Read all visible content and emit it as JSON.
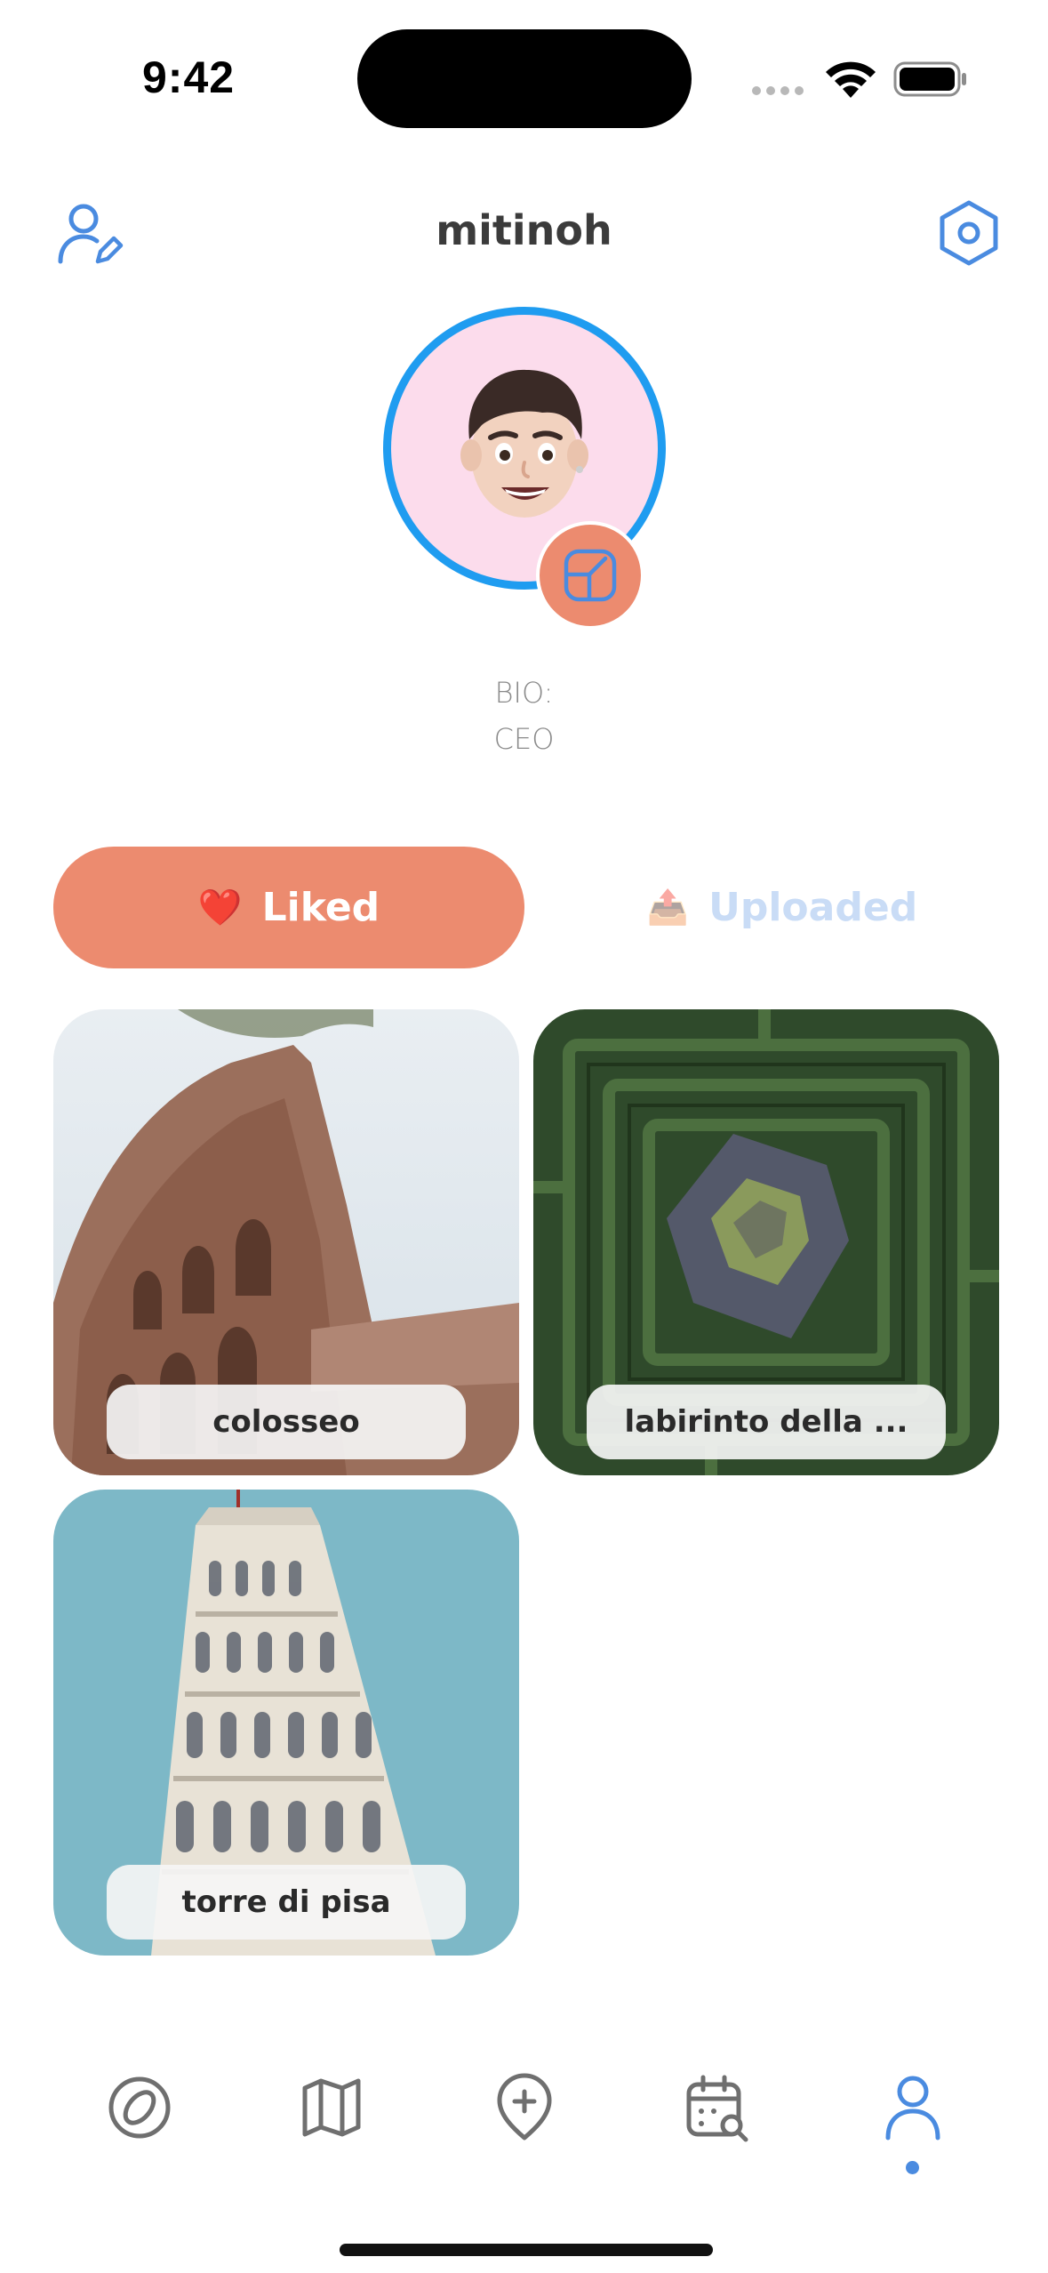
{
  "status_bar": {
    "time": "9:42"
  },
  "header": {
    "username": "mitinoh",
    "edit_profile_icon": "person-pencil-icon",
    "settings_icon": "hexagon-gear-icon"
  },
  "profile": {
    "avatar": "memoji-avatar",
    "badge_icon": "wallet-icon",
    "bio_label": "BIO:",
    "bio_text": "CEO"
  },
  "tabs": {
    "liked": {
      "emoji": "❤️",
      "label": "Liked"
    },
    "uploaded": {
      "emoji": "📤",
      "label": "Uploaded"
    }
  },
  "cards": [
    {
      "label": "colosseo"
    },
    {
      "label": "labirinto della ..."
    },
    {
      "label": "torre di pisa"
    }
  ],
  "bottom_nav": [
    {
      "name": "explore",
      "icon": "compass-icon"
    },
    {
      "name": "map",
      "icon": "map-icon"
    },
    {
      "name": "add",
      "icon": "add-location-icon"
    },
    {
      "name": "calendar",
      "icon": "calendar-search-icon"
    },
    {
      "name": "profile",
      "icon": "person-icon",
      "active": true
    }
  ],
  "colors": {
    "accent_orange": "#ec8b6f",
    "accent_blue": "#4a8be0",
    "ring_blue": "#1f9cf0",
    "avatar_bg": "#fcdcec",
    "uploaded_inactive": "#c9dcf6"
  }
}
